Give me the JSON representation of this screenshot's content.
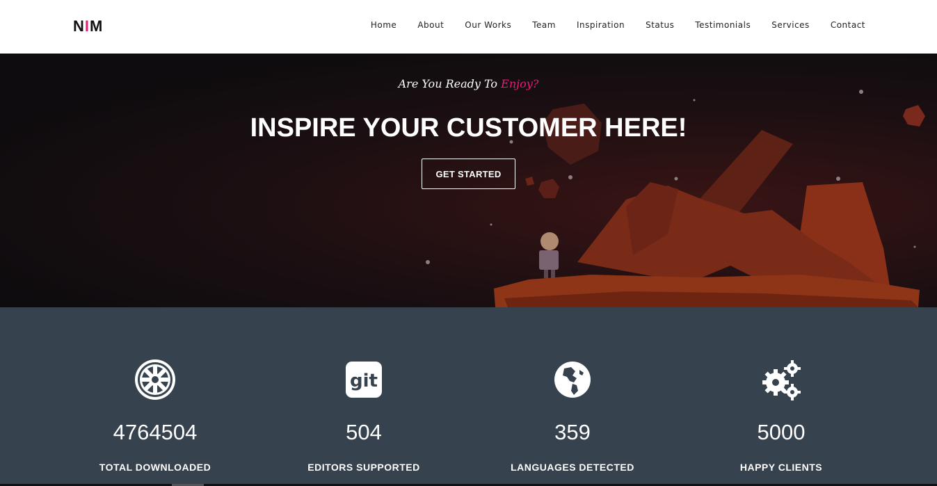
{
  "brand": {
    "logo_left": "N",
    "logo_accent": "I",
    "logo_right": "M",
    "accent_color": "#e91e79"
  },
  "nav": {
    "items": [
      "Home",
      "About",
      "Our Works",
      "Team",
      "Inspiration",
      "Status",
      "Testimonials",
      "Services",
      "Contact"
    ]
  },
  "hero": {
    "tagline_prefix": "Are You Ready To ",
    "tagline_accent": "Enjoy?",
    "headline": "INSPIRE YOUR CUSTOMER HERE!",
    "cta_label": "GET STARTED"
  },
  "stats": [
    {
      "icon": "empire-icon",
      "value": "4764504",
      "label": "TOTAL DOWNLOADED"
    },
    {
      "icon": "git-icon",
      "value": "504",
      "label": "EDITORS SUPPORTED"
    },
    {
      "icon": "globe-icon",
      "value": "359",
      "label": "LANGUAGES DETECTED"
    },
    {
      "icon": "gears-icon",
      "value": "5000",
      "label": "HAPPY CLIENTS"
    }
  ],
  "colors": {
    "stats_bg": "#36424e",
    "hero_bg": "#0e0c0e"
  }
}
